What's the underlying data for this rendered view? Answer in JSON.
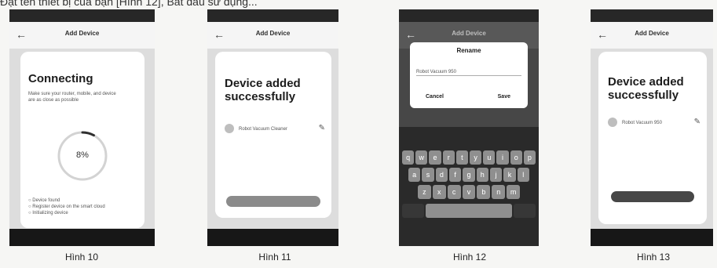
{
  "intro_text": "Đặt tên thiết bị của bạn [Hình 12], Bất đầu sử dụng...",
  "figures": [
    {
      "caption": "Hình 10",
      "header_title": "Add Device",
      "heading": "Connecting",
      "body_text": "Make sure your router, mobile, and device are as close as possible",
      "progress_label": "8%",
      "progress_fraction": 0.08,
      "steps": [
        "Device found",
        "Register device on the smart cloud",
        "Initializing device"
      ]
    },
    {
      "caption": "Hình 11",
      "header_title": "Add Device",
      "heading_line1": "Device added",
      "heading_line2": "successfully",
      "device_name": "Robot Vacuum Cleaner"
    },
    {
      "caption": "Hình 12",
      "header_title": "Add Device",
      "dialog_title": "Rename",
      "dialog_value": "Robot Vacuum 950",
      "cancel_label": "Cancel",
      "save_label": "Save",
      "keyboard_rows": [
        [
          "q",
          "w",
          "e",
          "r",
          "t",
          "y",
          "u",
          "i",
          "o",
          "p"
        ],
        [
          "a",
          "s",
          "d",
          "f",
          "g",
          "h",
          "j",
          "k",
          "l"
        ],
        [
          "z",
          "x",
          "c",
          "v",
          "b",
          "n",
          "m"
        ]
      ]
    },
    {
      "caption": "Hình 13",
      "header_title": "Add Device",
      "heading_line1": "Device added",
      "heading_line2": "successfully",
      "device_name": "Robot Vacuum 950"
    }
  ]
}
